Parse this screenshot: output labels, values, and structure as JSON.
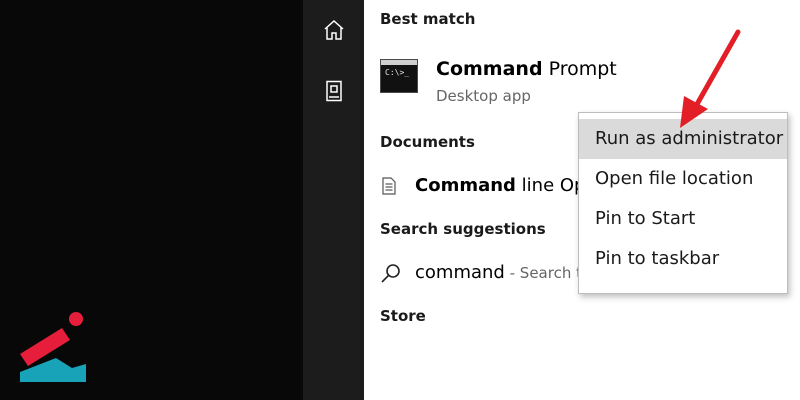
{
  "colors": {
    "left_background": "#080808",
    "rail_background": "#1c1c1c",
    "panel_background": "#ffffff",
    "menu_hover": "#dadada",
    "arrow": "#e21f26",
    "logo_red": "#e61e3c",
    "logo_teal": "#19a3b8"
  },
  "rail": {
    "home_icon": "home-icon",
    "documents_icon": "documents-icon"
  },
  "best_match": {
    "header": "Best match",
    "icon": "command-prompt-icon",
    "icon_text": "C:\\>_",
    "title_bold": "Command",
    "title_rest": " Prompt",
    "subtitle": "Desktop app"
  },
  "documents": {
    "header": "Documents",
    "icon": "document-icon",
    "title_bold": "Command",
    "title_rest": " line Opt"
  },
  "search_suggestions": {
    "header": "Search suggestions",
    "icon": "search-icon",
    "term": "command",
    "hint": " - Search th"
  },
  "store": {
    "header": "Store"
  },
  "context_menu": {
    "items": [
      {
        "label": "Run as administrator",
        "highlighted": true
      },
      {
        "label": "Open file location",
        "highlighted": false
      },
      {
        "label": "Pin to Start",
        "highlighted": false
      },
      {
        "label": "Pin to taskbar",
        "highlighted": false
      }
    ]
  }
}
